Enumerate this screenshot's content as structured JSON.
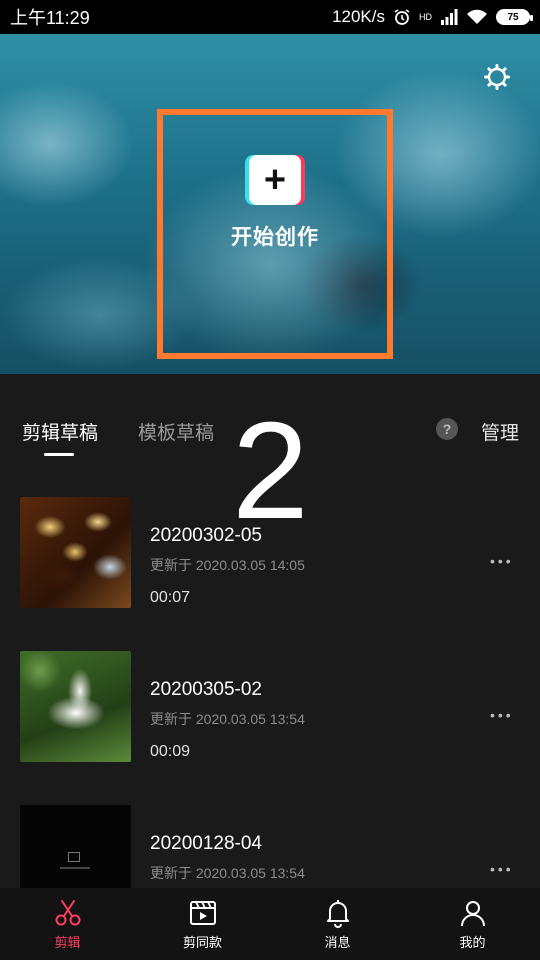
{
  "status": {
    "time": "上午11:29",
    "speed": "120K/s",
    "hd": "HD",
    "battery": "75"
  },
  "hero": {
    "create_label": "开始创作",
    "plus": "+"
  },
  "tabs": {
    "active": "剪辑草稿",
    "inactive": "模板草稿",
    "help": "?",
    "manage": "管理"
  },
  "overlay": {
    "number": "2"
  },
  "drafts": [
    {
      "title": "20200302-05",
      "updated": "更新于 2020.03.05 14:05",
      "duration": "00:07"
    },
    {
      "title": "20200305-02",
      "updated": "更新于 2020.03.05 13:54",
      "duration": "00:09"
    },
    {
      "title": "20200128-04",
      "updated": "更新于 2020.03.05 13:54",
      "duration": ""
    }
  ],
  "more": "•••",
  "nav": [
    {
      "label": "剪辑",
      "icon": "scissors-icon"
    },
    {
      "label": "剪同款",
      "icon": "clapperboard-icon"
    },
    {
      "label": "消息",
      "icon": "bell-icon"
    },
    {
      "label": "我的",
      "icon": "person-icon"
    }
  ],
  "colors": {
    "accent": "#ff3d5f",
    "highlight_box": "#ff7a2f"
  }
}
